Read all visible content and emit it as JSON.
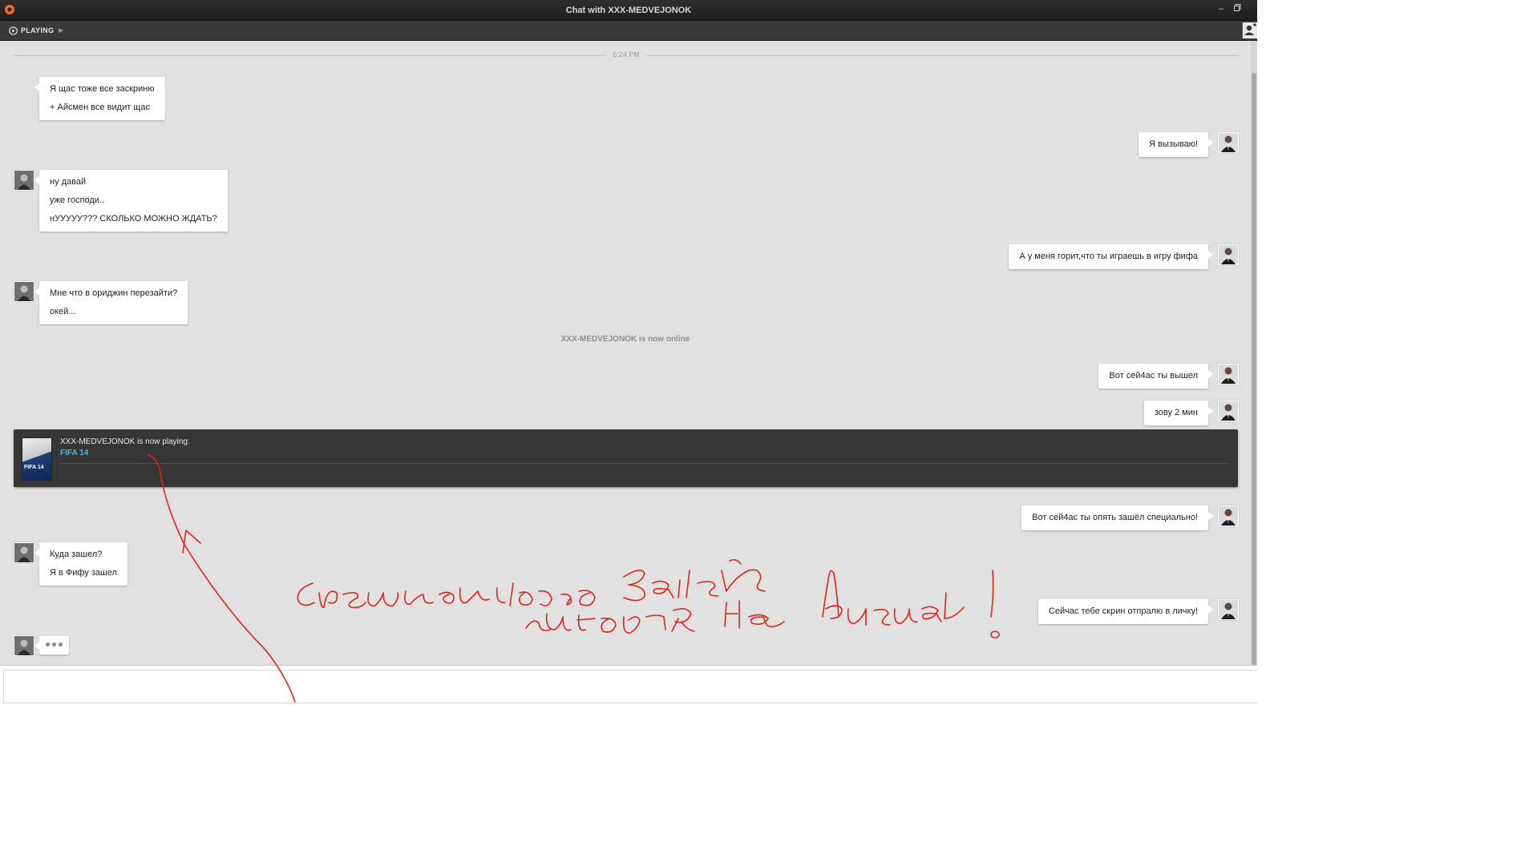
{
  "window": {
    "title": "Chat with XXX-MEDVEJONOK",
    "controls": [
      "minimize-icon",
      "restore-icon"
    ]
  },
  "toolbar": {
    "status_label": "PLAYING",
    "icon": "play-circle-icon"
  },
  "chat": {
    "time_separator": "6:24 PM",
    "messages": [
      {
        "side": "left",
        "lines": [
          "Я щас тоже все заскриню",
          "+ Айсмен все видит щас"
        ]
      },
      {
        "side": "right",
        "lines": [
          "Я вызываю!"
        ]
      },
      {
        "side": "left",
        "lines": [
          "ну давай",
          "уже господи..",
          "нУУУУУ??? СКОЛЬКО МОЖНО ЖДАТЬ?"
        ]
      },
      {
        "side": "right",
        "lines": [
          "А у меня горит,что ты играешь в игру фифа"
        ]
      },
      {
        "side": "left",
        "lines": [
          "Мне что в ориджин перезайти?",
          "окей..."
        ]
      },
      {
        "side": "right",
        "lines": [
          "Вот сей4ас ты вышел"
        ]
      },
      {
        "side": "right",
        "lines": [
          "зову 2 мин"
        ]
      },
      {
        "side": "right",
        "lines": [
          "Вот сей4ас ты опять зашёл специально!"
        ]
      },
      {
        "side": "left",
        "lines": [
          "Куда зашел?",
          "Я в Фифу зашел"
        ]
      },
      {
        "side": "right",
        "lines": [
          "Сейчас тебе скрин отпралю в личку!"
        ]
      }
    ],
    "status_online": "XXX-MEDVEJONOK is now online",
    "now_playing": {
      "text": "XXX-MEDVEJONOK is now playing:",
      "game": "FIFA 14",
      "cover_label": "FIFA 14"
    }
  },
  "colors": {
    "titlebar": "#262626",
    "toolbar": "#3a3a3a",
    "chat_bg": "#e1e1e1",
    "game_link": "#4fb6e8",
    "annotation": "#e2231a",
    "origin_orange": "#f26c22"
  }
}
